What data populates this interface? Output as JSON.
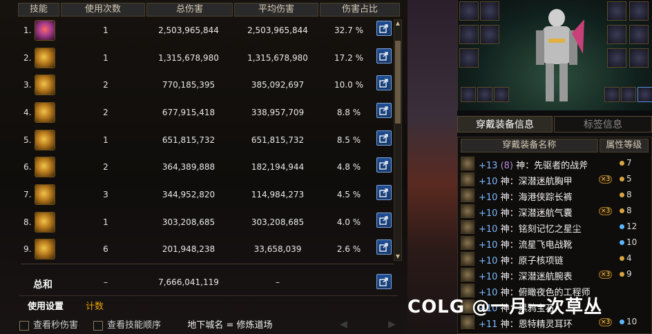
{
  "stats_panel": {
    "headers": [
      "技能",
      "使用次数",
      "总伤害",
      "平均伤害",
      "伤害占比"
    ],
    "rows": [
      {
        "rank": "1.",
        "uses": "1",
        "total": "2,503,965,844",
        "avg": "2,503,965,844",
        "pct": "32.7 %"
      },
      {
        "rank": "2.",
        "uses": "1",
        "total": "1,315,678,980",
        "avg": "1,315,678,980",
        "pct": "17.2 %"
      },
      {
        "rank": "3.",
        "uses": "2",
        "total": "770,185,395",
        "avg": "385,092,697",
        "pct": "10.0 %"
      },
      {
        "rank": "4.",
        "uses": "2",
        "total": "677,915,418",
        "avg": "338,957,709",
        "pct": "8.8 %"
      },
      {
        "rank": "5.",
        "uses": "1",
        "total": "651,815,732",
        "avg": "651,815,732",
        "pct": "8.5 %"
      },
      {
        "rank": "6.",
        "uses": "2",
        "total": "364,389,888",
        "avg": "182,194,944",
        "pct": "4.8 %"
      },
      {
        "rank": "7.",
        "uses": "3",
        "total": "344,952,820",
        "avg": "114,984,273",
        "pct": "4.5 %"
      },
      {
        "rank": "8.",
        "uses": "1",
        "total": "303,208,685",
        "avg": "303,208,685",
        "pct": "4.0 %"
      },
      {
        "rank": "9.",
        "uses": "6",
        "total": "201,948,238",
        "avg": "33,658,039",
        "pct": "2.6 %"
      }
    ],
    "total": {
      "label": "总和",
      "uses": "–",
      "total": "7,666,041,119",
      "avg": "–"
    },
    "bottom_tabs": [
      "使用设置",
      "计数"
    ],
    "checkbox_dps": "查看秒伤害",
    "checkbox_order": "查看技能顺序",
    "dungeon": "地下城名 = 修炼道场",
    "nav_prev": "◀",
    "nav_next": "▶"
  },
  "equip_panel": {
    "tabs": [
      "穿戴装备信息",
      "标签信息"
    ],
    "headers": [
      "穿戴装备名称",
      "属性等级"
    ],
    "items": [
      {
        "plus": "+13",
        "bracket": "(8)",
        "name": "神：先驱者的战斧",
        "badge": "",
        "level": "7",
        "dot_color": "#d9a441"
      },
      {
        "plus": "+10",
        "bracket": "",
        "name": "神：深潜迷航胸甲",
        "badge": "×3",
        "level": "5",
        "dot_color": "#d9a441"
      },
      {
        "plus": "+10",
        "bracket": "",
        "name": "神：海港侠踪长裤",
        "badge": "",
        "level": "8",
        "dot_color": "#d9a441"
      },
      {
        "plus": "+10",
        "bracket": "",
        "name": "神：深潜迷航气囊",
        "badge": "×3",
        "level": "8",
        "dot_color": "#d9a441"
      },
      {
        "plus": "+10",
        "bracket": "",
        "name": "神：铭刻记忆之星尘",
        "badge": "",
        "level": "12",
        "dot_color": "#5ab8ff"
      },
      {
        "plus": "+10",
        "bracket": "",
        "name": "神：流星飞电战靴",
        "badge": "",
        "level": "10",
        "dot_color": "#5ab8ff"
      },
      {
        "plus": "+10",
        "bracket": "",
        "name": "神：原子核项链",
        "badge": "",
        "level": "4",
        "dot_color": "#d9a441"
      },
      {
        "plus": "+10",
        "bracket": "",
        "name": "神：深潜迷航腕表",
        "badge": "×3",
        "level": "9",
        "dot_color": "#d9a441"
      },
      {
        "plus": "+10",
        "bracket": "",
        "name": "神：俯瞰夜色的工程师",
        "badge": "",
        "level": "",
        "dot_color": ""
      },
      {
        "plus": "+10",
        "bracket": "",
        "name": "神：黑鸦宝石",
        "badge": "",
        "level": "",
        "dot_color": ""
      },
      {
        "plus": "+11",
        "bracket": "",
        "name": "神：恩特精灵耳环",
        "badge": "×3",
        "level": "10",
        "dot_color": "#5ab8ff"
      }
    ]
  },
  "watermark": "COLG @一月一次草丛",
  "colors": {
    "gold": "#d9a441",
    "blue_plus": "#7fb9ff",
    "purple": "#b58ad6",
    "accent_tab": "#e8a200"
  }
}
